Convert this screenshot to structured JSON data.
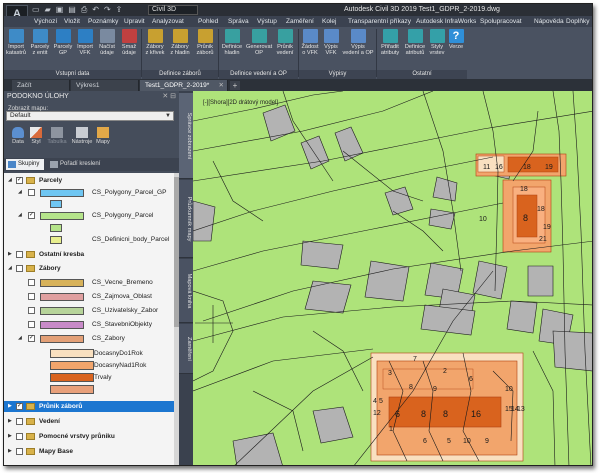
{
  "titlebar": {
    "logo": "A",
    "workspace": "Civil 3D",
    "window_title": "Autodesk Civil 3D 2019    Test1_GDPR_2-2019.dwg"
  },
  "menu_tabs": [
    "Výchozí",
    "Vložit",
    "Poznámky",
    "Upravit",
    "Analyzovat",
    "Pohled",
    "Správa",
    "Výstup",
    "Zaměření",
    "Kolej",
    "Transparentní příkazy",
    "Autodesk InfraWorks",
    "Spolupracovat",
    "Nápověda",
    "Doplňky"
  ],
  "ribbon": {
    "buttons": [
      {
        "label": "Import\nkatastrů",
        "color": "#3e8bc7"
      },
      {
        "label": "Parcely\nz entit",
        "color": "#3e8bc7"
      },
      {
        "label": "Parcely\nGP",
        "color": "#2d7fc4"
      },
      {
        "label": "Import\nVFK",
        "color": "#2d7fc4"
      },
      {
        "label": "Načíst\núdaje",
        "color": "#7a8aa0"
      },
      {
        "label": "Smaž\núdaje",
        "color": "#c04040"
      },
      {
        "label": "Zábory\nz křivek",
        "color": "#c8a030"
      },
      {
        "label": "Zábory\nz hladin",
        "color": "#c8a030"
      },
      {
        "label": "Průnik\nzáborů",
        "color": "#c8a030"
      },
      {
        "label": "Definice\nhladin",
        "color": "#38a0a0"
      },
      {
        "label": "Generovat\nOP",
        "color": "#38a0a0"
      },
      {
        "label": "Průnik\nvedení",
        "color": "#38a0a0"
      },
      {
        "label": "Žádost\no VFK",
        "color": "#5a8ac8"
      },
      {
        "label": "Výpis\nVFK",
        "color": "#5a8ac8"
      },
      {
        "label": "Výpis\nvedení a OP",
        "color": "#5a8ac8"
      },
      {
        "label": "Přiřadit\natributy",
        "color": "#34a0a8"
      },
      {
        "label": "Definice\natributů",
        "color": "#34a0a8"
      },
      {
        "label": "Styly\nvrstev",
        "color": "#34a0a8"
      },
      {
        "label": "Verze",
        "color": "#2f8fd8"
      }
    ],
    "panels": [
      "Vstupní data",
      "Definice záborů",
      "Definice vedení a OP",
      "Výpisy",
      "Ostatní"
    ]
  },
  "doc_tabs": [
    {
      "label": "Začít",
      "active": false
    },
    {
      "label": "Výkres1",
      "active": false
    },
    {
      "label": "Test1_GDPR_2-2019*",
      "active": true
    }
  ],
  "left_panel": {
    "title": "PODOKNO ÚLOHY",
    "map_select_label": "Zobrazit mapu:",
    "map_select_value": "Default",
    "tools": [
      {
        "label": "Data",
        "disabled": false
      },
      {
        "label": "Styl",
        "disabled": false
      },
      {
        "label": "Tabulka",
        "disabled": true
      },
      {
        "label": "Nástroje",
        "disabled": false
      },
      {
        "label": "Mapy",
        "disabled": false
      }
    ],
    "subtabs": [
      {
        "label": "Skupiny",
        "active": true
      },
      {
        "label": "Pořadí kreslení",
        "active": false
      }
    ],
    "tree": [
      {
        "label": "Parcely",
        "level": 0,
        "type": "group",
        "checked": true,
        "expanded": true
      },
      {
        "label": "CS_Polygony_Parcel_GP",
        "level": 1,
        "type": "layer",
        "checked": false,
        "expanded": true
      },
      {
        "label": "",
        "level": 2,
        "type": "style",
        "swatch": "#6fc6f2"
      },
      {
        "label": "CS_Polygony_Parcel",
        "level": 1,
        "type": "layer",
        "checked": true,
        "expanded": true
      },
      {
        "label": "",
        "level": 2,
        "type": "style",
        "swatch": "#b5e48a"
      },
      {
        "label": "CS_Definicni_body_Parcel",
        "level": 2,
        "type": "style",
        "swatch": "#e8ef8e"
      },
      {
        "label": "Ostatní kresba",
        "level": 0,
        "type": "group",
        "checked": false,
        "expanded": false
      },
      {
        "label": "Zábory",
        "level": 0,
        "type": "group",
        "checked": false,
        "expanded": true
      },
      {
        "label": "CS_Vecne_Bremeno",
        "level": 1,
        "type": "layer",
        "checked": false,
        "swatch": "#d7b25a"
      },
      {
        "label": "CS_Zajmova_Oblast",
        "level": 1,
        "type": "layer",
        "checked": false,
        "swatch": "#e0a0a0"
      },
      {
        "label": "CS_Uzivatelsky_Zabor",
        "level": 1,
        "type": "layer",
        "checked": false,
        "swatch": "#b7d49a"
      },
      {
        "label": "CS_StavebniObjekty",
        "level": 1,
        "type": "layer",
        "checked": false,
        "swatch": "#c88ac8"
      },
      {
        "label": "CS_Zabory",
        "level": 1,
        "type": "layer",
        "checked": true,
        "expanded": true
      },
      {
        "label": "DocasnyDo1Rok",
        "level": 2,
        "type": "style",
        "swatch": "#f9e0c0"
      },
      {
        "label": "DocasnyNad1Rok",
        "level": 2,
        "type": "style",
        "swatch": "#f2a56c"
      },
      {
        "label": "Trvaly",
        "level": 2,
        "type": "style",
        "swatch": "#d9631e"
      },
      {
        "label": "",
        "level": 2,
        "type": "style",
        "swatch": "#e8a07a"
      },
      {
        "label": "Průnik záborů",
        "level": 0,
        "type": "group",
        "checked": true,
        "expanded": false,
        "selected": true
      },
      {
        "label": "Vedení",
        "level": 0,
        "type": "group",
        "checked": false,
        "expanded": false
      },
      {
        "label": "Pomocné vrstvy průniku",
        "level": 0,
        "type": "group",
        "checked": false,
        "expanded": false
      },
      {
        "label": "Mapy Base",
        "level": 0,
        "type": "group",
        "checked": false,
        "expanded": false
      }
    ]
  },
  "vertical_tabs": [
    "Správce zobrazení",
    "Průzkumník mapy",
    "Mapová kniha",
    "Zaměření"
  ],
  "map": {
    "view_label": "[-][Shora][2D drátový model]",
    "parcel_numbers_top": [
      "11",
      "16",
      "18",
      "19"
    ],
    "parcel_numbers_mid": [
      "18",
      "8",
      "18",
      "10",
      "21",
      "19"
    ],
    "parcel_numbers_bottom": [
      "7",
      "3",
      "2",
      "6",
      "8",
      "9",
      "4",
      "5",
      "12",
      "10",
      "1",
      "6",
      "8",
      "8",
      "16",
      "15",
      "14",
      "13",
      "6",
      "5",
      "10",
      "9"
    ],
    "colors": {
      "parcel": "#aee37a",
      "building": "#b3b3b3",
      "temporary": "#f2a56c",
      "temporary_light": "#f9e0c0",
      "permanent": "#d9631e",
      "line": "#1a1a1a"
    }
  }
}
